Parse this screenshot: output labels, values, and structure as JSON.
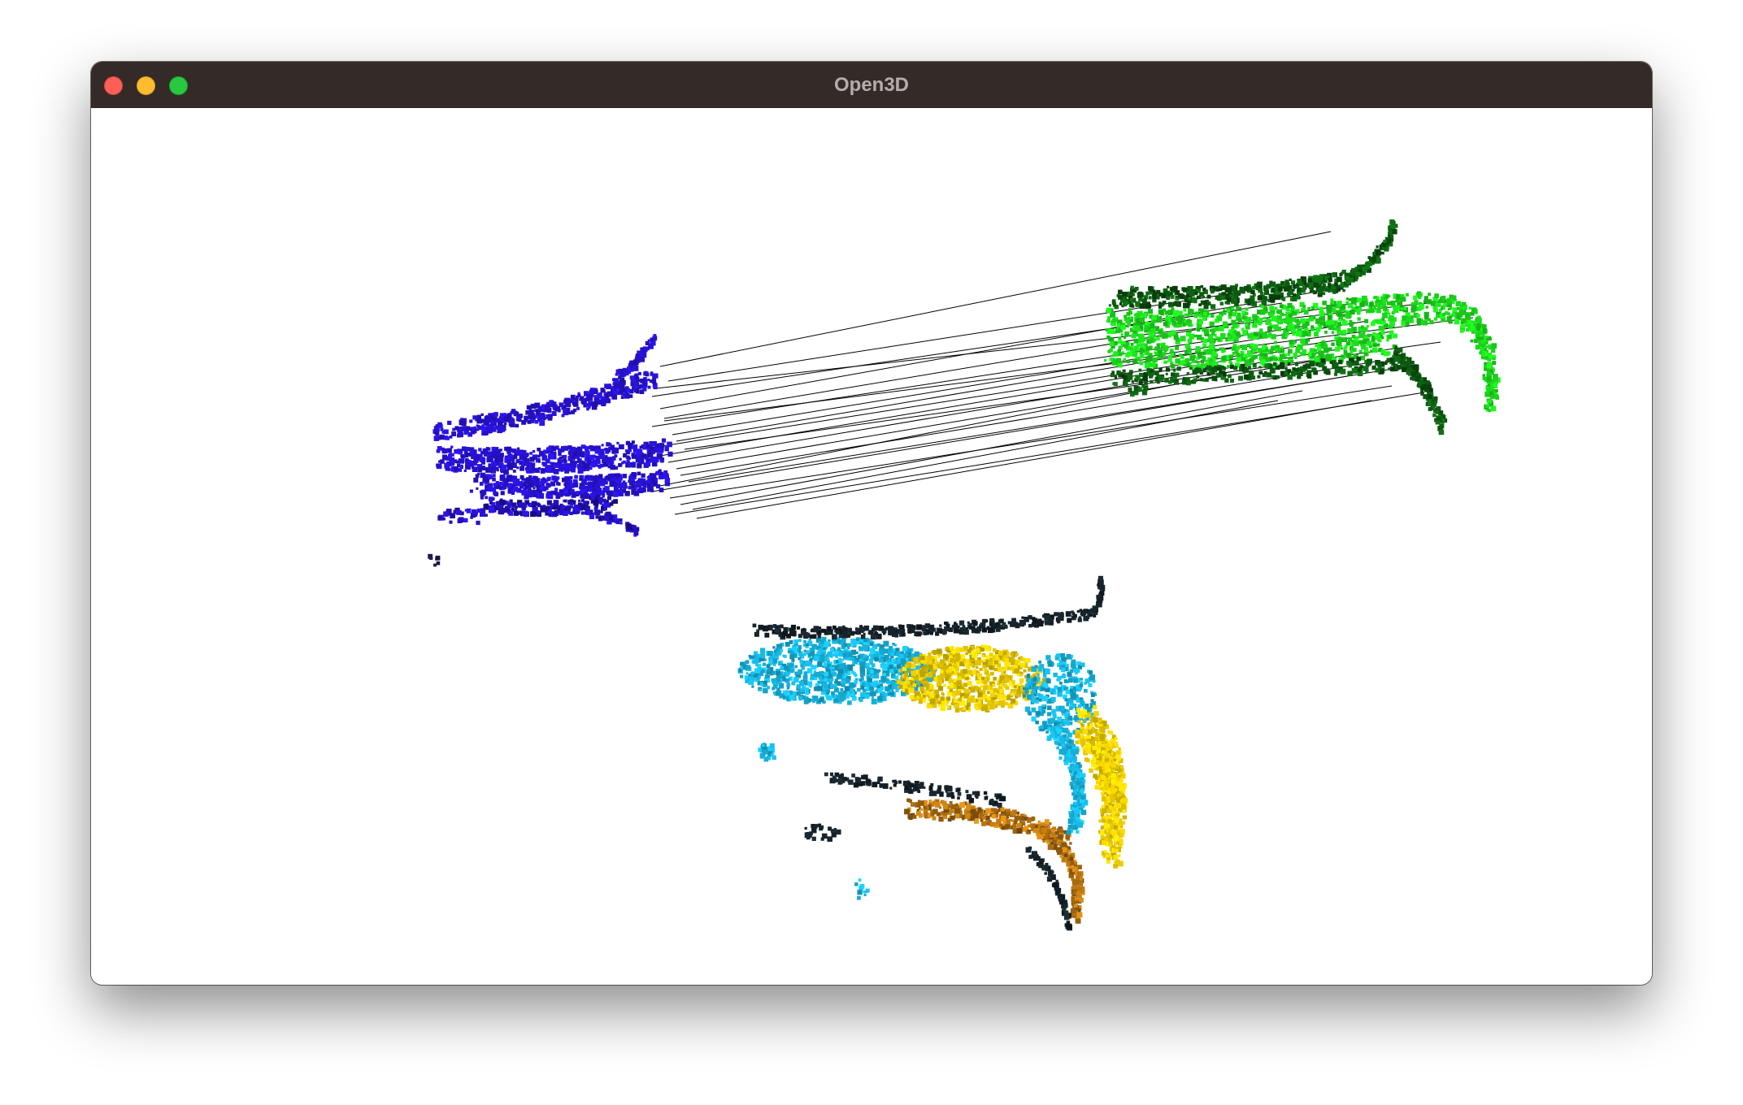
{
  "window": {
    "title": "Open3D"
  },
  "colors": {
    "titlebar": "#342b29",
    "source_cloud": "#2a13e0",
    "target_cloud": "#1ee81e",
    "target_cloud_dark": "#0f6e14",
    "merged_cyan": "#19c4f2",
    "merged_yellow": "#ffdd00",
    "merged_dark": "#1b2a33",
    "merged_orange": "#d98a14",
    "correspondence_lines": "#000000"
  },
  "icons": {
    "close": "close-icon",
    "minimize": "minimize-icon",
    "zoom": "zoom-icon"
  }
}
